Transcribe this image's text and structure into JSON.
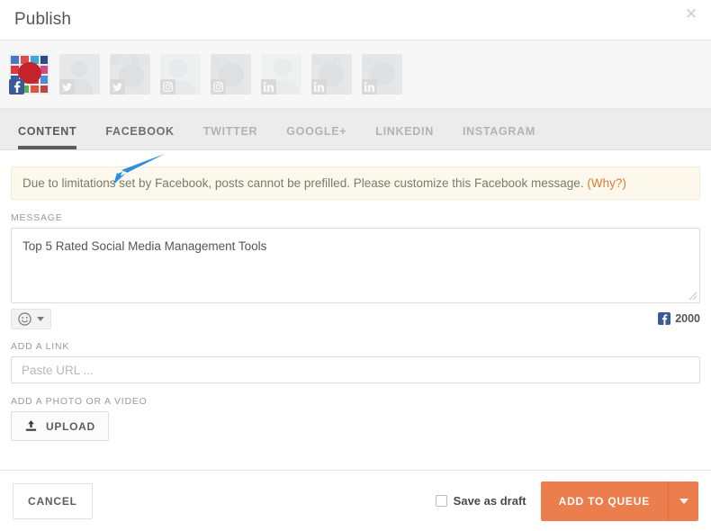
{
  "header": {
    "title": "Publish",
    "close_icon": "close-icon"
  },
  "accounts": [
    {
      "network": "facebook",
      "selected": true,
      "badge_label": "f"
    },
    {
      "network": "twitter",
      "selected": false,
      "badge_label": "t"
    },
    {
      "network": "twitter",
      "selected": false,
      "badge_label": "t"
    },
    {
      "network": "instagram",
      "selected": false,
      "badge_label": "ig"
    },
    {
      "network": "instagram",
      "selected": false,
      "badge_label": "ig"
    },
    {
      "network": "linkedin",
      "selected": false,
      "badge_label": "in"
    },
    {
      "network": "linkedin",
      "selected": false,
      "badge_label": "in"
    },
    {
      "network": "linkedin",
      "selected": false,
      "badge_label": "in"
    }
  ],
  "tabs": [
    {
      "label": "CONTENT",
      "state": "active"
    },
    {
      "label": "FACEBOOK",
      "state": "semi"
    },
    {
      "label": "TWITTER",
      "state": "inactive"
    },
    {
      "label": "GOOGLE+",
      "state": "inactive"
    },
    {
      "label": "LINKEDIN",
      "state": "inactive"
    },
    {
      "label": "INSTAGRAM",
      "state": "inactive"
    }
  ],
  "alert": {
    "text": "Due to limitations set by Facebook, posts cannot be prefilled. Please customize this Facebook message. ",
    "link_text": "(Why?)",
    "link_color": "#e07b39",
    "background": "#fcf9ec",
    "border": "#f2ecd4"
  },
  "message": {
    "label": "MESSAGE",
    "value": "Top 5 Rated Social Media Management Tools",
    "placeholder": "",
    "emoji_icon": "smiley-icon",
    "counter_network": "facebook",
    "counter_value": "2000"
  },
  "link": {
    "label": "ADD A LINK",
    "value": "",
    "placeholder": "Paste URL ..."
  },
  "media": {
    "label": "ADD A PHOTO OR A VIDEO",
    "upload_label": "UPLOAD",
    "upload_icon": "upload-icon"
  },
  "annotation": {
    "shape": "arrow",
    "color": "#2e8fe0",
    "points_to": "add-a-link-input"
  },
  "footer": {
    "cancel_label": "CANCEL",
    "draft_label": "Save as draft",
    "draft_checked": false,
    "primary_label": "ADD TO QUEUE",
    "primary_color": "#ec7d4c",
    "dropdown_icon": "chevron-down-icon"
  }
}
